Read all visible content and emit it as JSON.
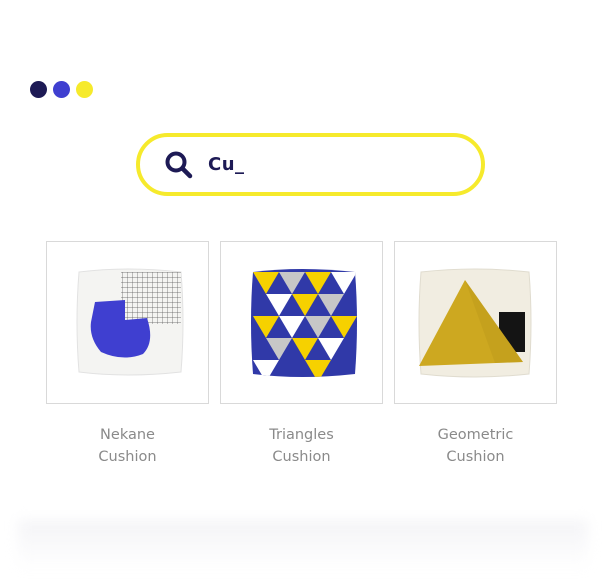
{
  "window_controls": {
    "colors": [
      "#1d1a55",
      "#3f3fd0",
      "#f6ea2c"
    ]
  },
  "search": {
    "icon": "search-icon",
    "value": "Cu_",
    "border_color": "#f6ea2c"
  },
  "products": [
    {
      "name": "Nekane",
      "type": "Cushion",
      "image": "nekane-cushion-image"
    },
    {
      "name": "Triangles",
      "type": "Cushion",
      "image": "triangles-cushion-image"
    },
    {
      "name": "Geometric",
      "type": "Cushion",
      "image": "geometric-cushion-image"
    }
  ]
}
